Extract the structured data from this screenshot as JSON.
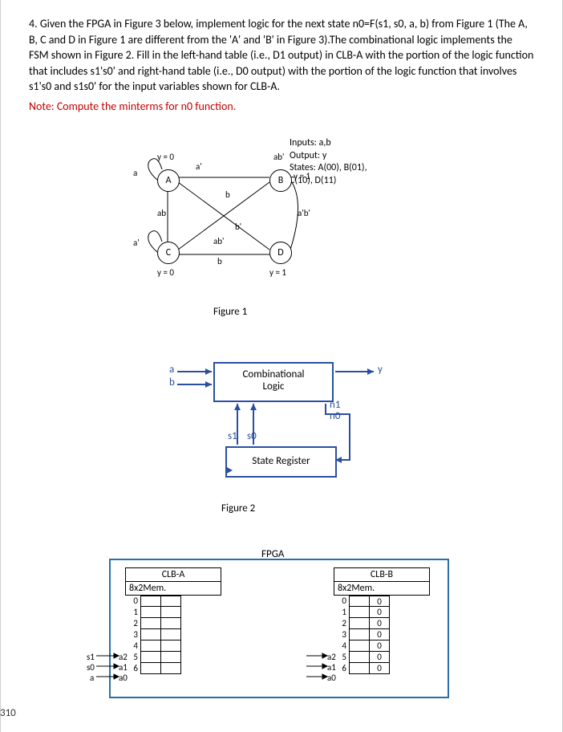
{
  "question": {
    "number": "4.",
    "text": "Given the FPGA in Figure 3 below, implement logic for the next state n0=F(s1, s0, a, b) from Figure 1 (The A, B, C and D in Figure 1 are different from the 'A' and 'B' in Figure 3).The combinational logic implements the FSM shown in Figure 2. Fill in the left-hand table (i.e., D1 output) in CLB-A with the portion of the logic function that includes s1's0' and right-hand table (i.e., D0 output) with the portion of the logic function that involves s1's0 and s1s0' for the input variables shown for CLB-A.",
    "note": "Note: Compute the minterms for n0 function."
  },
  "fig1": {
    "caption": "Figure 1",
    "sA": "A",
    "sB": "B",
    "sC": "C",
    "sD": "D",
    "yA": "y = 0",
    "yB": "y = 1",
    "yC": "y = 0",
    "yD": "y = 1",
    "inputsHdr": "Inputs: a,b",
    "outputHdr": "Output: y",
    "statesHdr": "States: A(00), B(01), C(10), D(11)",
    "e_ab_p": "ab'",
    "e_a_p": "a'",
    "e_a": "a",
    "e_ab": "ab",
    "e_b": "b",
    "e_b_p": "b'",
    "e_abp": "ab'",
    "e_aprbp": "a'b'"
  },
  "fig2": {
    "caption": "Figure 2",
    "a": "a",
    "b": "b",
    "y": "y",
    "comb1": "Combinational",
    "comb2": "Logic",
    "reg": "State Register",
    "s1": "s1",
    "s0": "s0",
    "n1": "n1",
    "n0": "n0"
  },
  "fig3": {
    "title": "FPGA",
    "clbA": "CLB-A",
    "clbB": "CLB-B",
    "mem": "8x2Mem.",
    "rowsA": [
      "0",
      "1",
      "2",
      "3",
      "4",
      "5",
      "6"
    ],
    "cellsB": [
      "0",
      "0",
      "0",
      "0",
      "0",
      "0",
      "0"
    ],
    "a2": "a2",
    "a1": "a1",
    "a0": "a0",
    "in_s1": "s1",
    "in_s0": "s0",
    "in_a": "a"
  },
  "sidenum": "310"
}
